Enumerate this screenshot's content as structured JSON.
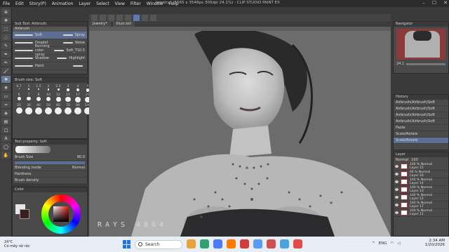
{
  "menu": [
    "File",
    "Edit",
    "Story(P)",
    "Animation",
    "Layer",
    "Select",
    "View",
    "Filter",
    "Window",
    "Help"
  ],
  "document_title": "Jewelry* (5565 x 3548px 300dpi 24.1%) - CLIP STUDIO PAINT EX",
  "canvas_tabs": [
    "Jewelry*",
    "Illust.tell"
  ],
  "subtool": {
    "title": "Sub Tool: Airbrush",
    "active_tab": "Airbrush",
    "items": [
      {
        "left": "Soft",
        "right": "Spray",
        "selected": true
      },
      {
        "left": "Droplet",
        "right": "Noise",
        "selected": false
      },
      {
        "left": "Running color spray",
        "right": "Soft_T10.5",
        "selected": false
      },
      {
        "left": "Shadow",
        "right": "Highlight",
        "selected": false
      },
      {
        "left": "Hard",
        "right": "",
        "selected": false
      }
    ]
  },
  "brushsize": {
    "title": "Brush size: Soft",
    "labels": [
      "0.7",
      "1",
      "1.5",
      "2",
      "2.5",
      "3",
      "4",
      "5",
      "6",
      "7",
      "8",
      "10",
      "12",
      "15",
      "17",
      "20",
      "25",
      "30",
      "40",
      "50",
      "60",
      "70",
      "80",
      "100"
    ]
  },
  "toolprop": {
    "title": "Tool property: Soft",
    "brush_label": "Soft",
    "rows": [
      {
        "label": "Brush Size",
        "value": "80.0"
      },
      {
        "label": "Blending mode",
        "value": "Normal"
      },
      {
        "label": "Hardness",
        "value": ""
      },
      {
        "label": "Brush density",
        "value": ""
      }
    ]
  },
  "color_panel_title": "Color",
  "signature": "RAYS 4864",
  "navigator_title": "Navigator",
  "navigator_zoom": "24.1",
  "history": {
    "title": "History",
    "items": [
      "Airbrush(Airbrush)Soft",
      "Airbrush(Airbrush)Soft",
      "Airbrush(Airbrush)Soft",
      "Airbrush(Airbrush)Soft",
      "Paste",
      "Scale/Rotate",
      "Scale/Rotate"
    ]
  },
  "layers": {
    "title": "Layer",
    "blend": "Normal",
    "opacity": "100",
    "items": [
      {
        "pct": "100 %",
        "mode": "Normal",
        "name": "Layer 15"
      },
      {
        "pct": "66 %",
        "mode": "Normal",
        "name": "Layer 16"
      },
      {
        "pct": "100 %",
        "mode": "Normal",
        "name": "Layer 14"
      },
      {
        "pct": "100 %",
        "mode": "Normal",
        "name": "Layer 13"
      },
      {
        "pct": "100 %",
        "mode": "Normal",
        "name": "Layer 12"
      },
      {
        "pct": "100 %",
        "mode": "Normal",
        "name": "Layer 17"
      },
      {
        "pct": "100 %",
        "mode": "Normal",
        "name": "Layer 11"
      }
    ]
  },
  "taskbar": {
    "temp": "24°C",
    "weather": "Có mây rải rác",
    "search": "Search",
    "lang": "ENG",
    "time": "2:34 AM",
    "date": "1/20/2026",
    "colors": {
      "start": "#1a73e8",
      "apps": [
        "#e8a33c",
        "#2fa36b",
        "#4b7bf5",
        "#ff7b00",
        "#d23c3c",
        "#5a9bf6",
        "#d04f4f",
        "#4aa3df",
        "#e04a4a"
      ]
    }
  }
}
